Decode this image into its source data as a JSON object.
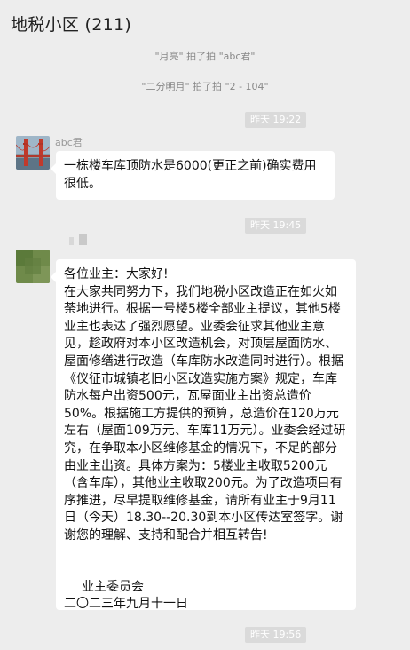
{
  "header": {
    "title": "地税小区 (211)"
  },
  "system_messages": [
    "\"月亮\" 拍了拍 \"abc君\"",
    "\"二分明月\" 拍了拍 \"2 - 104\""
  ],
  "timestamps": [
    "昨天 19:22",
    "昨天 19:45",
    "昨天 19:56"
  ],
  "messages": [
    {
      "sender": "abc君",
      "avatar_icon": "golden-gate-bridge-avatar",
      "text": "一栋楼车库顶防水是6000(更正之前)确实费用很低。"
    },
    {
      "sender": "",
      "avatar_icon": "blurred-green-avatar",
      "greeting": "各位业主：大家好!",
      "body": "在大家共同努力下，我们地税小区改造正在如火如荼地进行。根据一号楼5楼全部业主提议，其他5楼业主也表达了强烈愿望。业委会征求其他业主意见，趁政府对本小区改造机会，对顶层屋面防水、屋面修缮进行改造（车库防水改造同时进行）。根据《仪征市城镇老旧小区改造实施方案》规定，车库防水每户出资500元，瓦屋面业主出资总造价50%。根据施工方提供的预算，总造价在120万元左右（屋面109万元、车库11万元）。业委会经过研究，在争取本小区维修基金的情况下，不足的部分由业主出资。具体方案为：5楼业主收取5200元（含车库），其他业主收取200元。为了改造项目有序推进，尽早提取维修基金，请所有业主于9月11日（今天）18.30--20.30到本小区传达室签字。谢谢您的理解、支持和配合并相互转告!",
      "signature": "业主委员会",
      "date": "二〇二三年九月十一日"
    }
  ],
  "colors": {
    "background": "#ededed",
    "bubble": "#ffffff",
    "time_pill": "#dadada"
  }
}
